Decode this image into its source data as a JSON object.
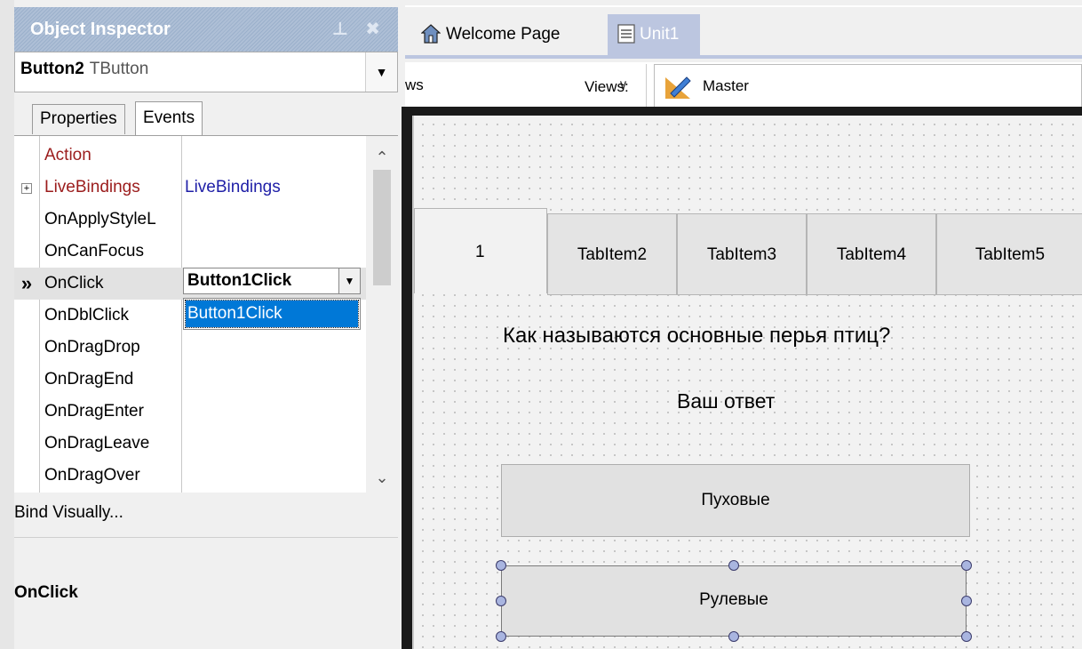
{
  "object_inspector": {
    "title": "Object Inspector",
    "pin_icon": "pin-icon",
    "close_icon": "close-icon",
    "selected_component": {
      "name": "Button2",
      "type": "TButton"
    },
    "tabs": [
      {
        "label": "Properties"
      },
      {
        "label": "Events",
        "active": true
      }
    ],
    "events": [
      {
        "name": "Action",
        "value": "",
        "color": "#9b1c1c"
      },
      {
        "name": "LiveBindings",
        "value": "LiveBindings",
        "color": "#9b1c1c",
        "expandable": true
      },
      {
        "name": "OnApplyStyleL",
        "value": ""
      },
      {
        "name": "OnCanFocus",
        "value": ""
      },
      {
        "name": "OnClick",
        "value": "Button1Click",
        "selected": true
      },
      {
        "name": "OnDblClick",
        "value": ""
      },
      {
        "name": "OnDragDrop",
        "value": ""
      },
      {
        "name": "OnDragEnd",
        "value": ""
      },
      {
        "name": "OnDragEnter",
        "value": ""
      },
      {
        "name": "OnDragLeave",
        "value": ""
      },
      {
        "name": "OnDragOver",
        "value": ""
      }
    ],
    "current_row_marker": "»",
    "dropdown_item": "Button1Click",
    "bind_visually": "Bind Visually...",
    "description_title": "OnClick"
  },
  "editor": {
    "doc_tabs": [
      {
        "label": "Welcome Page",
        "icon": "home-icon"
      },
      {
        "label": "Unit1",
        "icon": "unit-file-icon",
        "active": true
      }
    ],
    "toolbar": {
      "style_combo_value": "ws",
      "views_label": "Views:",
      "views_value": "Master",
      "views_icon": "master-view-icon"
    },
    "form": {
      "tabs": [
        "1",
        "TabItem2",
        "TabItem3",
        "TabItem4",
        "TabItem5"
      ],
      "question": "Как называются основные перья птиц?",
      "answer_label": "Ваш ответ",
      "buttons": [
        "Пуховые",
        "Рулевые"
      ]
    }
  }
}
